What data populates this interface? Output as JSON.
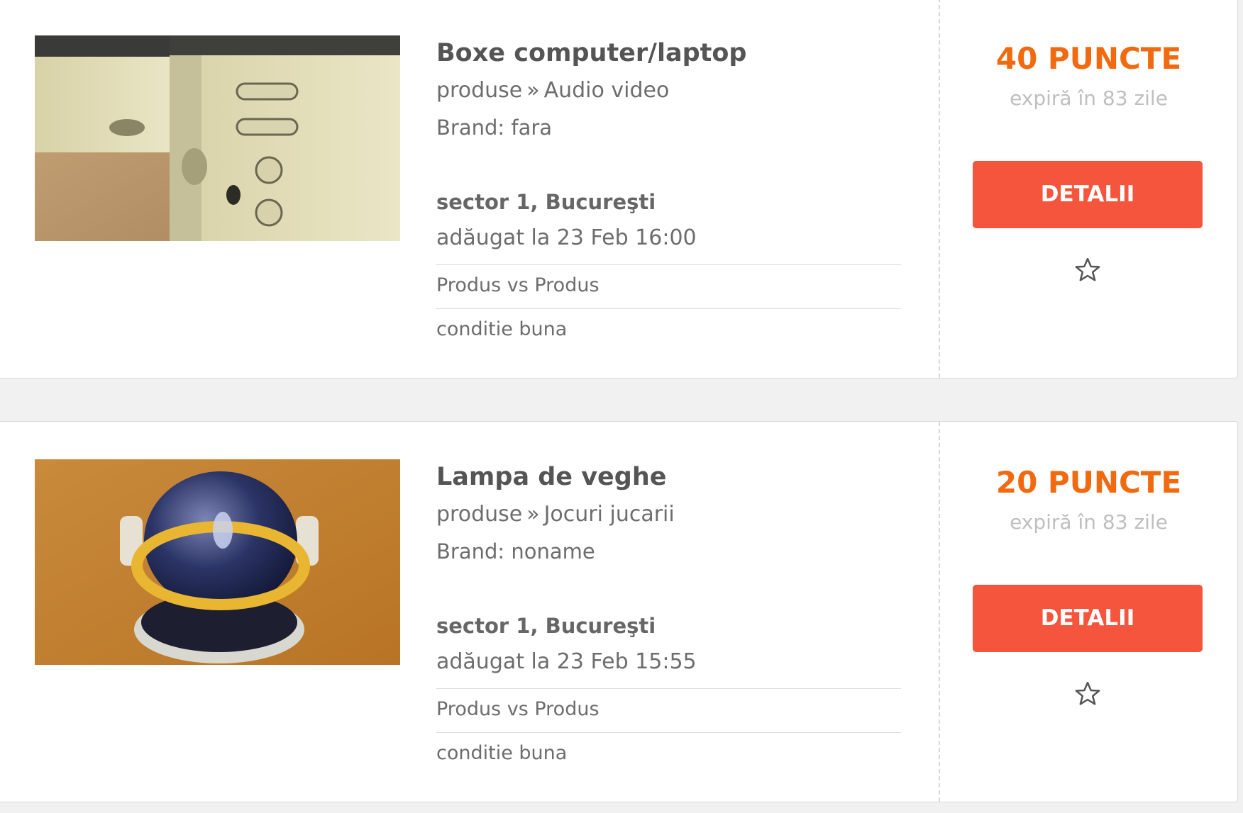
{
  "listings": [
    {
      "title": "Boxe computer/laptop",
      "category_root": "produse",
      "category_separator": "»",
      "category": "Audio video",
      "brand": "Brand: fara",
      "location": "sector 1, Bucureşti",
      "added": "adăugat la 23 Feb 16:00",
      "exchange_type": "Produs vs Produs",
      "condition": "conditie buna",
      "points": "40 PUNCTE",
      "expires": "expiră în 83 zile",
      "details_label": "DETALII",
      "favorite_icon": "star-outline-icon"
    },
    {
      "title": "Lampa de veghe",
      "category_root": "produse",
      "category_separator": "»",
      "category": "Jocuri jucarii",
      "brand": "Brand: noname",
      "location": "sector 1, Bucureşti",
      "added": "adăugat la 23 Feb 15:55",
      "exchange_type": "Produs vs Produs",
      "condition": "conditie buna",
      "points": "20 PUNCTE",
      "expires": "expiră în 83 zile",
      "details_label": "DETALII",
      "favorite_icon": "star-outline-icon"
    }
  ],
  "colors": {
    "accent_orange": "#f26a0f",
    "button_red": "#f4553c",
    "page_background": "#f1f1f1",
    "muted_text": "#bfbfbf"
  }
}
